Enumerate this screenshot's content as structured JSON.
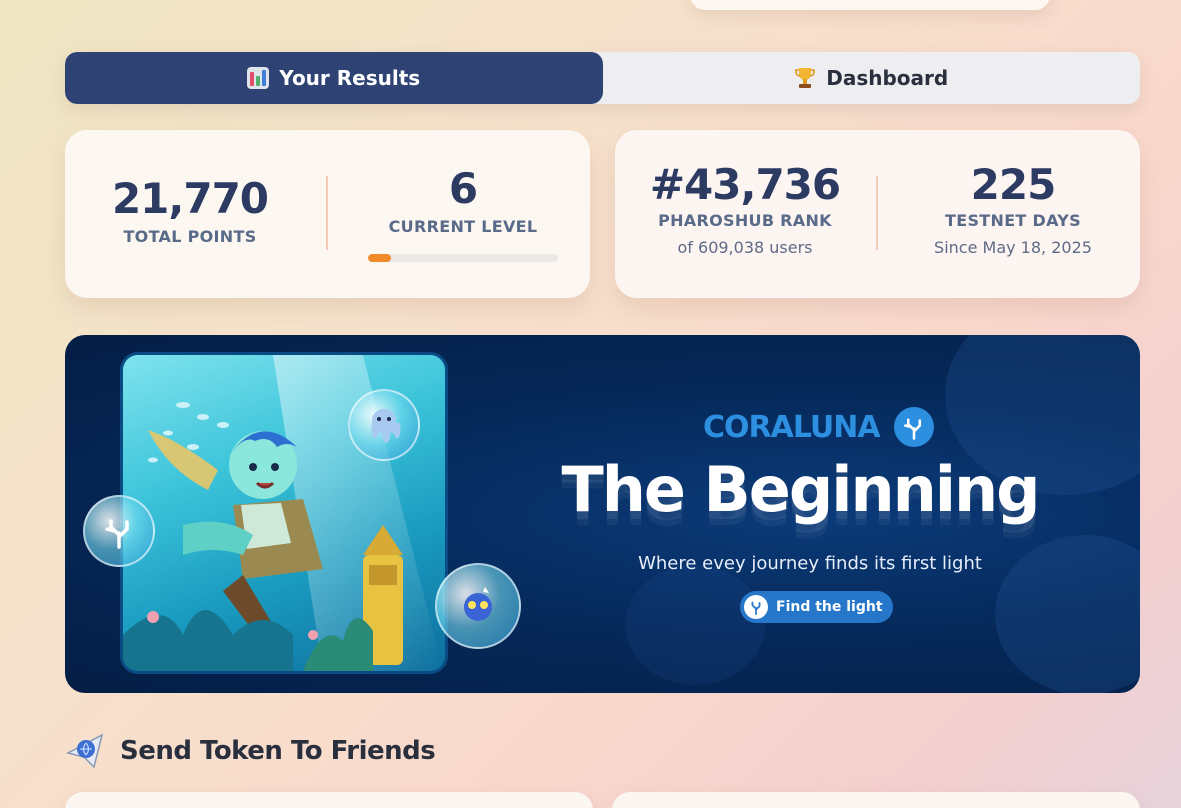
{
  "tabs": [
    {
      "label": "Your Results",
      "icon": "bar-chart-icon",
      "active": true
    },
    {
      "label": "Dashboard",
      "icon": "trophy-icon",
      "active": false
    }
  ],
  "stats": {
    "total_points": {
      "value": "21,770",
      "label": "TOTAL POINTS"
    },
    "current_level": {
      "value": "6",
      "label": "CURRENT LEVEL",
      "progress": 0.12
    },
    "rank": {
      "value": "#43,736",
      "label": "PHAROSHUB RANK",
      "sub": "of 609,038 users"
    },
    "testnet_days": {
      "value": "225",
      "label": "TESTNET DAYS",
      "sub": "Since May 18, 2025"
    }
  },
  "banner": {
    "brand": "CORALUNA",
    "headline": "The Beginning",
    "tagline": "Where evey journey finds its first  light",
    "cta": "Find the light"
  },
  "section": {
    "title": "Send Token To Friends",
    "icon": "paper-plane-icon"
  },
  "colors": {
    "tab_active": "#2e4374",
    "accent_orange": "#f08a2b",
    "brand_blue": "#2d8fe0",
    "banner_bg": "#062a5c"
  }
}
